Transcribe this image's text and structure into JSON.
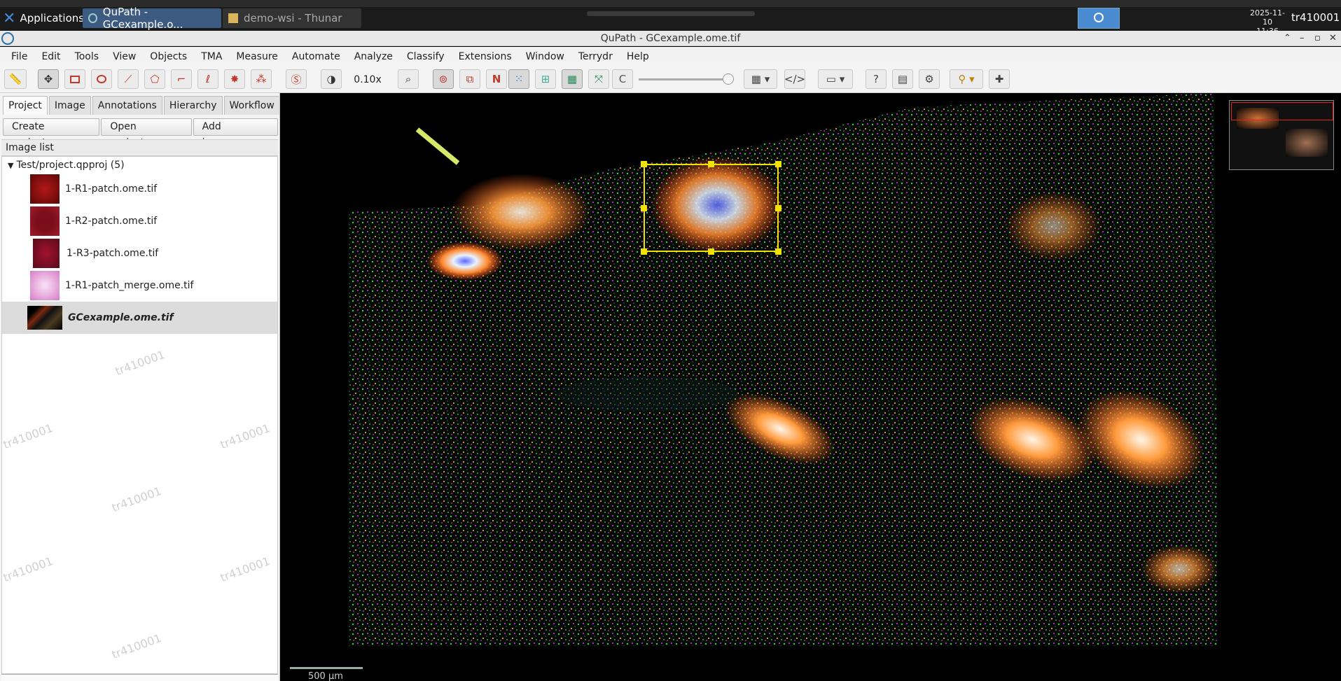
{
  "taskbar": {
    "apps_label": "Applications",
    "tasks": [
      {
        "label": "QuPath - GCexample.o...",
        "active": true
      },
      {
        "label": "demo-wsi - Thunar",
        "active": false
      }
    ],
    "clock_date": "2025-11-10",
    "clock_time": "11:36",
    "user": "tr410001"
  },
  "window": {
    "title": "QuPath - GCexample.ome.tif"
  },
  "menu": [
    "File",
    "Edit",
    "Tools",
    "View",
    "Objects",
    "TMA",
    "Measure",
    "Automate",
    "Analyze",
    "Classify",
    "Extensions",
    "Window",
    "Terrydr",
    "Help"
  ],
  "toolbar": {
    "zoom": "0.10x",
    "tools": [
      "ruler-icon",
      "move-icon",
      "rectangle-icon",
      "ellipse-icon",
      "line-icon",
      "polygon-icon",
      "polyline-icon",
      "brush-icon",
      "wand-icon",
      "points-icon",
      "selection-mode-icon",
      "contrast-icon",
      "zoom-to-fit-icon",
      "show-annotations-icon",
      "fill-annotations-icon",
      "show-names-icon",
      "show-tma-icon",
      "show-detections-icon",
      "fill-detections-icon",
      "connections-icon",
      "channel-c-icon",
      "grid-icon",
      "script-icon",
      "display-icon",
      "help-icon",
      "log-icon",
      "settings-icon",
      "brush-style-icon",
      "plugin-icon"
    ],
    "accent_color": "#c0392b"
  },
  "left_panel": {
    "tabs": [
      "Project",
      "Image",
      "Annotations",
      "Hierarchy",
      "Workflow"
    ],
    "active_tab": "Project",
    "buttons": [
      "Create project...",
      "Open project...",
      "Add images..."
    ],
    "image_list_label": "Image list",
    "project_root": "Test/project.qpproj (5)",
    "images": [
      {
        "name": "1-R1-patch.ome.tif",
        "thumb_color": "#8a1010",
        "selected": false
      },
      {
        "name": "1-R2-patch.ome.tif",
        "thumb_color": "#7a0d1a",
        "selected": false
      },
      {
        "name": "1-R3-patch.ome.tif",
        "thumb_color": "#8a0f2a",
        "selected": false
      },
      {
        "name": "1-R1-patch_merge.ome.tif",
        "thumb_color": "#e9a6dc",
        "selected": false
      },
      {
        "name": "GCexample.ome.tif",
        "thumb_color": "#1a1a1a",
        "selected": true
      }
    ]
  },
  "viewer": {
    "scale_label": "500 µm",
    "watermark": "tr410001",
    "selection_color": "#f2e200"
  }
}
